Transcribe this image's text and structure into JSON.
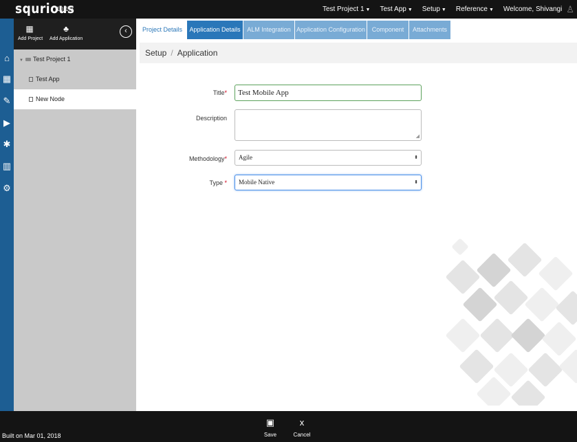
{
  "app": {
    "name": "squrious",
    "version": "10.1.3"
  },
  "topnav": {
    "items": [
      {
        "label": "Test Project 1"
      },
      {
        "label": "Test App"
      },
      {
        "label": "Setup"
      },
      {
        "label": "Reference"
      }
    ],
    "welcome": "Welcome, Shivangi"
  },
  "rail": {
    "icons": [
      "home-icon",
      "calendar-icon",
      "pencil-icon",
      "play-icon",
      "bug-icon",
      "bar-chart-icon",
      "gears-icon"
    ]
  },
  "toolbar": {
    "add_project": "Add Project",
    "add_application": "Add Application"
  },
  "tree": {
    "root": "Test Project 1",
    "children": [
      "Test App",
      "New Node"
    ]
  },
  "tabs": [
    {
      "label": "Project Details"
    },
    {
      "label": "Application Details"
    },
    {
      "label": "ALM Integration"
    },
    {
      "label": "Application Configuration"
    },
    {
      "label": "Component"
    },
    {
      "label": "Attachments"
    }
  ],
  "breadcrumb": {
    "parent": "Setup",
    "separator": "/",
    "current": "Application"
  },
  "form": {
    "title_label": "Title",
    "title_value": "Test Mobile App",
    "description_label": "Description",
    "description_value": "",
    "methodology_label": "Methodology",
    "methodology_value": "Agile",
    "type_label": "Type",
    "type_value": "Mobile Native",
    "required_mark": "*"
  },
  "footer": {
    "built": "Built on Mar 01, 2018",
    "save_label": "Save",
    "cancel_label": "Cancel"
  },
  "colors": {
    "rail": "#1d5e93",
    "tab_active": "#2a77b9",
    "tab_inactive": "#79abd5",
    "bar": "#141414"
  }
}
